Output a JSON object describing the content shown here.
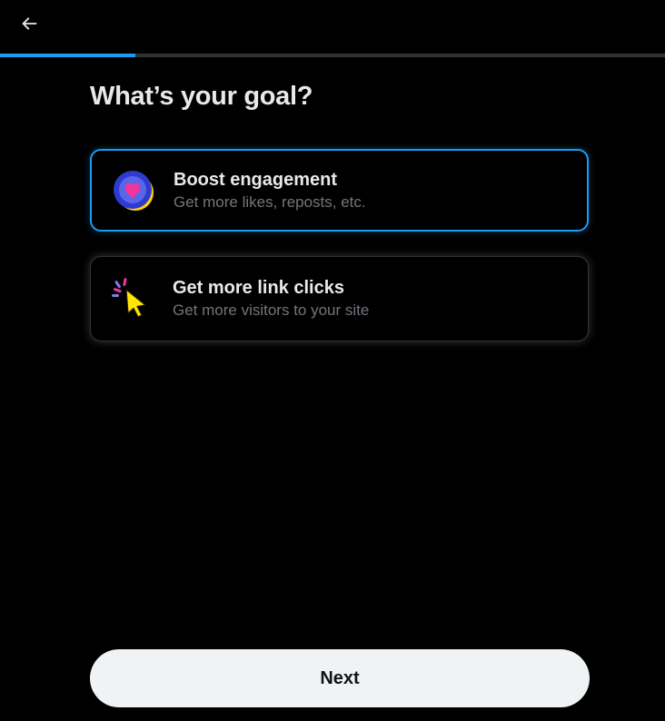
{
  "header": {
    "back_icon": "arrow-left-icon",
    "progress_fraction": 0.203
  },
  "title": "What’s your goal?",
  "options": [
    {
      "title": "Boost engagement",
      "subtitle": "Get more likes, reposts, etc.",
      "icon": "heart-badge-icon",
      "selected": true
    },
    {
      "title": "Get more link clicks",
      "subtitle": "Get more visitors to your site",
      "icon": "cursor-click-icon",
      "selected": false
    }
  ],
  "next_label": "Next",
  "colors": {
    "accent": "#1d9bf0",
    "background": "#000000",
    "button_bg": "#eff3f4"
  }
}
